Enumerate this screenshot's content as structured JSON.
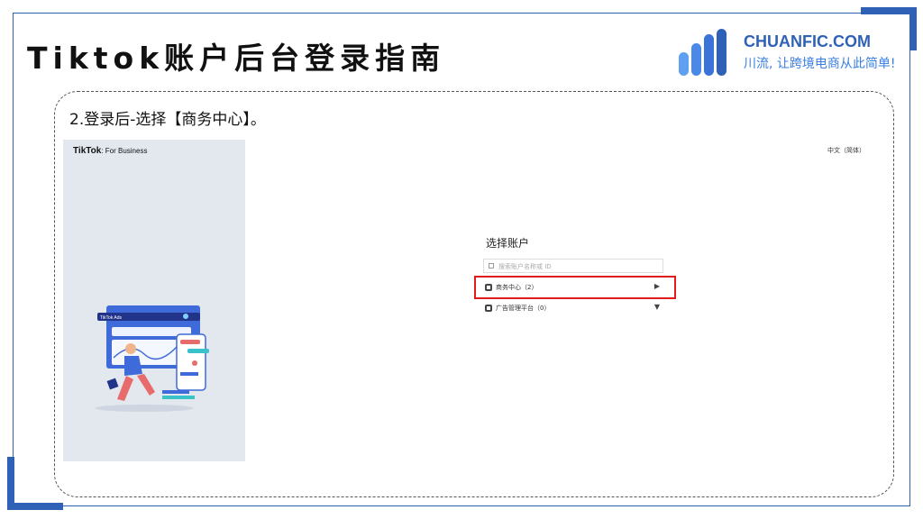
{
  "slide": {
    "title": "Tiktok账户后台登录指南",
    "logo_name": "CHUANFIC.COM",
    "logo_slogan": "川流, 让跨境电商从此简单!",
    "step_text": "2.登录后-选择【商务中心】。"
  },
  "screenshot": {
    "brand": "TikTok",
    "brand_sub": ": For Business",
    "language": "中文（简体）",
    "select_title": "选择账户",
    "search_placeholder": "搜索账户名称或 ID",
    "accounts": [
      {
        "label": "商务中心（2）",
        "arrow": "▶"
      },
      {
        "label": "广告管理平台（0）",
        "arrow": "▼"
      }
    ],
    "illustration_label": "TikTok Ads"
  },
  "colors": {
    "accent": "#2f62b7",
    "highlight": "#e01b1b",
    "panel": "#e3e8ef"
  }
}
